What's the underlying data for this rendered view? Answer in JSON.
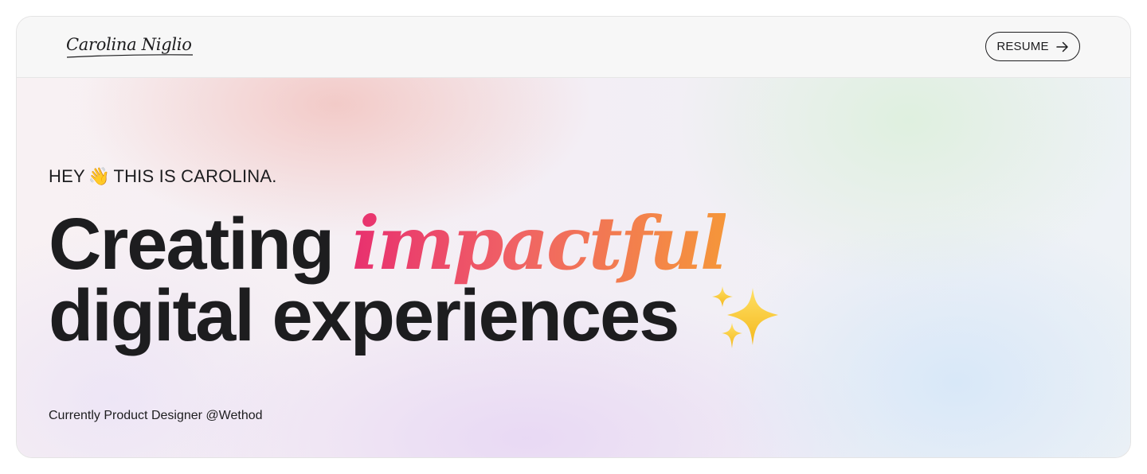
{
  "header": {
    "logo_text": "Carolina Niglio",
    "resume_label": "RESUME",
    "resume_icon": "arrow-right-icon"
  },
  "hero": {
    "greeting_before": "HEY",
    "greeting_emoji": "👋",
    "greeting_after": "THIS IS CAROLINA.",
    "headline_word_1": "Creating",
    "headline_accent": "impactful",
    "headline_line_2": "digital experiences",
    "sparkles_icon": "sparkles-icon",
    "subtitle": "Currently Product Designer @Wethod"
  },
  "colors": {
    "text": "#1d1d1f",
    "accent_start": "#e8306f",
    "accent_end": "#f5963a",
    "sparkle": "#f7c948"
  }
}
